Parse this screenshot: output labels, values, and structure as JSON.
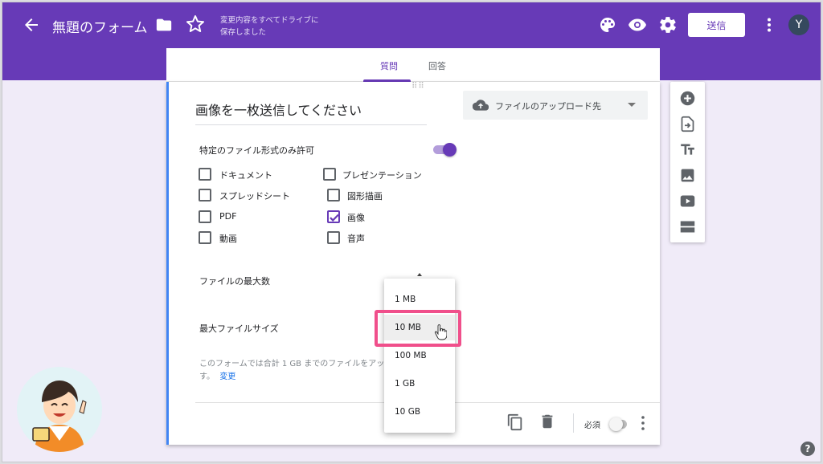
{
  "header": {
    "title": "無題のフォーム",
    "save_status_line1": "変更内容をすべてドライブに",
    "save_status_line2": "保存しました",
    "send_label": "送信",
    "avatar_initial": "Y",
    "color": "#673ab7"
  },
  "tabs": [
    {
      "label": "質問",
      "active": true
    },
    {
      "label": "回答",
      "active": false
    }
  ],
  "question": {
    "title": "画像を一枚送信してください",
    "type_label": "ファイルのアップロード先",
    "restrict_label": "特定のファイル形式のみ許可",
    "restrict_on": true,
    "file_types": [
      {
        "label": "ドキュメント",
        "checked": false
      },
      {
        "label": "プレゼンテーション",
        "checked": false
      },
      {
        "label": "スプレッドシート",
        "checked": false
      },
      {
        "label": "図形描画",
        "checked": false
      },
      {
        "label": "PDF",
        "checked": false
      },
      {
        "label": "画像",
        "checked": true
      },
      {
        "label": "動画",
        "checked": false
      },
      {
        "label": "音声",
        "checked": false
      }
    ],
    "max_files_label": "ファイルの最大数",
    "max_size_label": "最大ファイルサイズ",
    "note_line1": "このフォームでは合計 1 GB までのファイルをアップ",
    "note_line2_prefix": "す。",
    "note_change_link": "変更",
    "required_label": "必須",
    "required_on": false
  },
  "size_dropdown": {
    "options": [
      "1 MB",
      "10 MB",
      "100 MB",
      "1 GB",
      "10 GB"
    ],
    "selected": "10 MB",
    "highlight_color": "#f04f8b"
  },
  "side_tools": [
    "add-question-icon",
    "import-questions-icon",
    "add-title-icon",
    "add-image-icon",
    "add-video-icon",
    "add-section-icon"
  ],
  "help_label": "?"
}
